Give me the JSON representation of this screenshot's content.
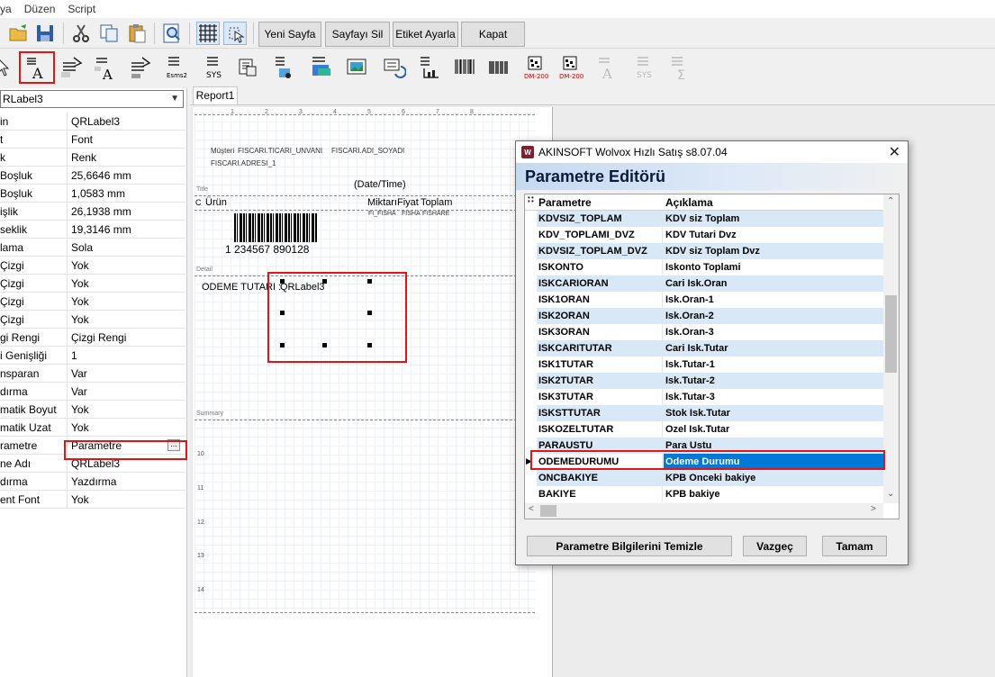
{
  "menu": [
    "ya",
    "Düzen",
    "Script"
  ],
  "toolbar": {
    "buttons": [
      "Yeni Sayfa",
      "Sayfayı Sil",
      "Etiket Ayarla",
      "Kapat"
    ]
  },
  "toolbar2": {
    "labels": {
      "esms": "Esms2",
      "sys": "SYS",
      "dm1": "DM-200",
      "dm2": "DM-200",
      "sys2": "SYS"
    }
  },
  "left_panel": {
    "combo_value": "RLabel3",
    "properties": [
      {
        "name": "in",
        "value": "QRLabel3"
      },
      {
        "name": "t",
        "value": "Font"
      },
      {
        "name": "k",
        "value": "Renk"
      },
      {
        "name": "Boşluk",
        "value": "25,6646 mm"
      },
      {
        "name": "Boşluk",
        "value": "1,0583 mm"
      },
      {
        "name": "işlik",
        "value": "26,1938 mm"
      },
      {
        "name": "seklik",
        "value": "19,3146 mm"
      },
      {
        "name": "lama",
        "value": "Sola"
      },
      {
        "name": "Çizgi",
        "value": "Yok"
      },
      {
        "name": "Çizgi",
        "value": "Yok"
      },
      {
        "name": "Çizgi",
        "value": "Yok"
      },
      {
        "name": "Çizgi",
        "value": "Yok"
      },
      {
        "name": "gi Rengi",
        "value": "Çizgi Rengi"
      },
      {
        "name": "i Genişliği",
        "value": "1"
      },
      {
        "name": "nsparan",
        "value": "Var"
      },
      {
        "name": "dırma",
        "value": "Var"
      },
      {
        "name": "matik Boyut",
        "value": "Yok"
      },
      {
        "name": "matik Uzat",
        "value": "Yok"
      },
      {
        "name": "rametre",
        "value": "Parametre"
      },
      {
        "name": "ne Adı",
        "value": "QRLabel3"
      },
      {
        "name": "dırma",
        "value": "Yazdırma"
      },
      {
        "name": "ent Font",
        "value": "Yok"
      }
    ]
  },
  "designer": {
    "tab": "Report1",
    "ruler": [
      "1",
      "2",
      "3",
      "4",
      "5",
      "6",
      "7",
      "8"
    ],
    "left_ticks": [
      "10",
      "11",
      "12",
      "13",
      "14"
    ],
    "bands": {
      "title": "Title",
      "detail": "Detail",
      "summary": "Summary",
      "column": "C"
    },
    "fields": {
      "musteri": "Müşteri",
      "unvan": "FISCARI.TICARI_UNVANI",
      "adi": "FISCARI.ADI_SOYADI",
      "adres": "FISCARI.ADRESI_1",
      "datetime": "(Date/Time)",
      "urun": "Ürün",
      "miktar": "Miktarı",
      "fiyat": "Fiyat",
      "toplam": "Toplam",
      "f1": "FI_FISHA",
      "f2": "FISHA",
      "f3": "FISHARE",
      "barcode": "1 234567 890128",
      "odeme": "ODEME TUTARI :",
      "qrlabel": "QRLabel3"
    }
  },
  "dialog": {
    "title": "AKINSOFT Wolvox Hızlı Satış s8.07.04",
    "header": "Parametre Editörü",
    "columns": [
      "Parametre",
      "Açıklama"
    ],
    "rows": [
      {
        "p": "KDVSIZ_TOPLAM",
        "a": "KDV siz Toplam"
      },
      {
        "p": "KDV_TOPLAMI_DVZ",
        "a": "KDV Tutari Dvz"
      },
      {
        "p": "KDVSIZ_TOPLAM_DVZ",
        "a": "KDV siz Toplam Dvz"
      },
      {
        "p": "ISKONTO",
        "a": "Iskonto Toplami"
      },
      {
        "p": "ISKCARIORAN",
        "a": "Cari Isk.Oran"
      },
      {
        "p": "ISK1ORAN",
        "a": "Isk.Oran-1"
      },
      {
        "p": "ISK2ORAN",
        "a": "Isk.Oran-2"
      },
      {
        "p": "ISK3ORAN",
        "a": "Isk.Oran-3"
      },
      {
        "p": "ISKCARITUTAR",
        "a": "Cari Isk.Tutar"
      },
      {
        "p": "ISK1TUTAR",
        "a": "Isk.Tutar-1"
      },
      {
        "p": "ISK2TUTAR",
        "a": "Isk.Tutar-2"
      },
      {
        "p": "ISK3TUTAR",
        "a": "Isk.Tutar-3"
      },
      {
        "p": "ISKSTTUTAR",
        "a": "Stok Isk.Tutar"
      },
      {
        "p": "ISKOZELTUTAR",
        "a": "Ozel Isk.Tutar"
      },
      {
        "p": "PARAUSTU",
        "a": "Para Ustu"
      },
      {
        "p": "ODEMEDURUMU",
        "a": "Odeme Durumu"
      },
      {
        "p": "ONCBAKIYE",
        "a": "KPB Onceki bakiye"
      },
      {
        "p": "BAKIYE",
        "a": "KPB bakiye"
      }
    ],
    "selected_index": 15,
    "buttons": {
      "clear": "Parametre Bilgilerini Temizle",
      "cancel": "Vazgeç",
      "ok": "Tamam"
    }
  },
  "colors": {
    "highlight_red": "#e01616",
    "selection_blue": "#0078d7",
    "row_alt": "#d9e8f6"
  }
}
